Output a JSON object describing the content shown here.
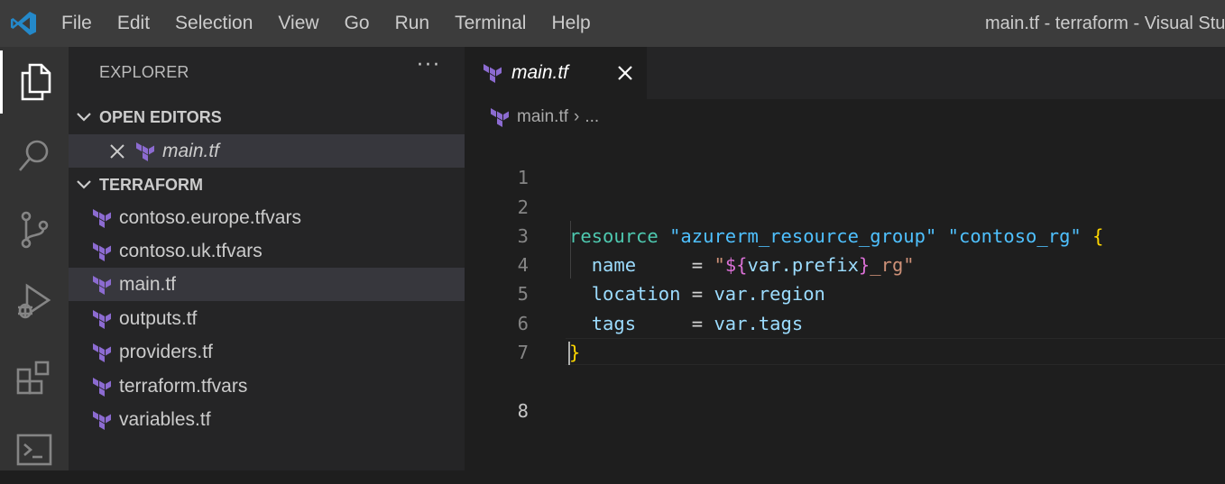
{
  "titlebar": {
    "menu": [
      "File",
      "Edit",
      "Selection",
      "View",
      "Go",
      "Run",
      "Terminal",
      "Help"
    ],
    "window_title": "main.tf - terraform - Visual Stu"
  },
  "activity_bar": {
    "items": [
      "explorer-icon",
      "search-icon",
      "source-control-icon",
      "run-debug-icon",
      "extensions-icon",
      "terminal-icon"
    ],
    "active": "explorer-icon"
  },
  "sidebar": {
    "title": "EXPLORER",
    "more": "···",
    "open_editors": {
      "header": "OPEN EDITORS",
      "items": [
        {
          "name": "main.tf",
          "italic": true
        }
      ]
    },
    "folder": {
      "header": "TERRAFORM",
      "files": [
        "contoso.europe.tfvars",
        "contoso.uk.tfvars",
        "main.tf",
        "outputs.tf",
        "providers.tf",
        "terraform.tfvars",
        "variables.tf"
      ],
      "selected": "main.tf"
    }
  },
  "editor": {
    "tab_label": "main.tf",
    "breadcrumb": {
      "file": "main.tf",
      "separator": "›",
      "ellipsis": "..."
    },
    "line_numbers": [
      "1",
      "2",
      "3",
      "4",
      "5",
      "6",
      "7",
      "8"
    ],
    "current_line": 8,
    "code": {
      "l2_keyword": "resource",
      "l2_type": "\"azurerm_resource_group\"",
      "l2_name": "\"contoso_rg\"",
      "l2_brace": "{",
      "l3_key": "name",
      "l3_eq": "     = ",
      "l3_q1": "\"",
      "l3_open": "${",
      "l3_var": "var.prefix",
      "l3_close": "}",
      "l3_rest": "_rg\"",
      "l4_key": "location",
      "l4_eq": " = ",
      "l4_val": "var.region",
      "l5_key": "tags",
      "l5_eq": "     = ",
      "l5_val": "var.tags",
      "l6_brace": "}"
    }
  },
  "colors": {
    "terraform_purple": "#8c6bd1",
    "keyword_teal": "#4ec9b0",
    "string_blue": "#4fc1ff",
    "identifier": "#9cdcfe",
    "bracket_gold": "#ffd700"
  }
}
